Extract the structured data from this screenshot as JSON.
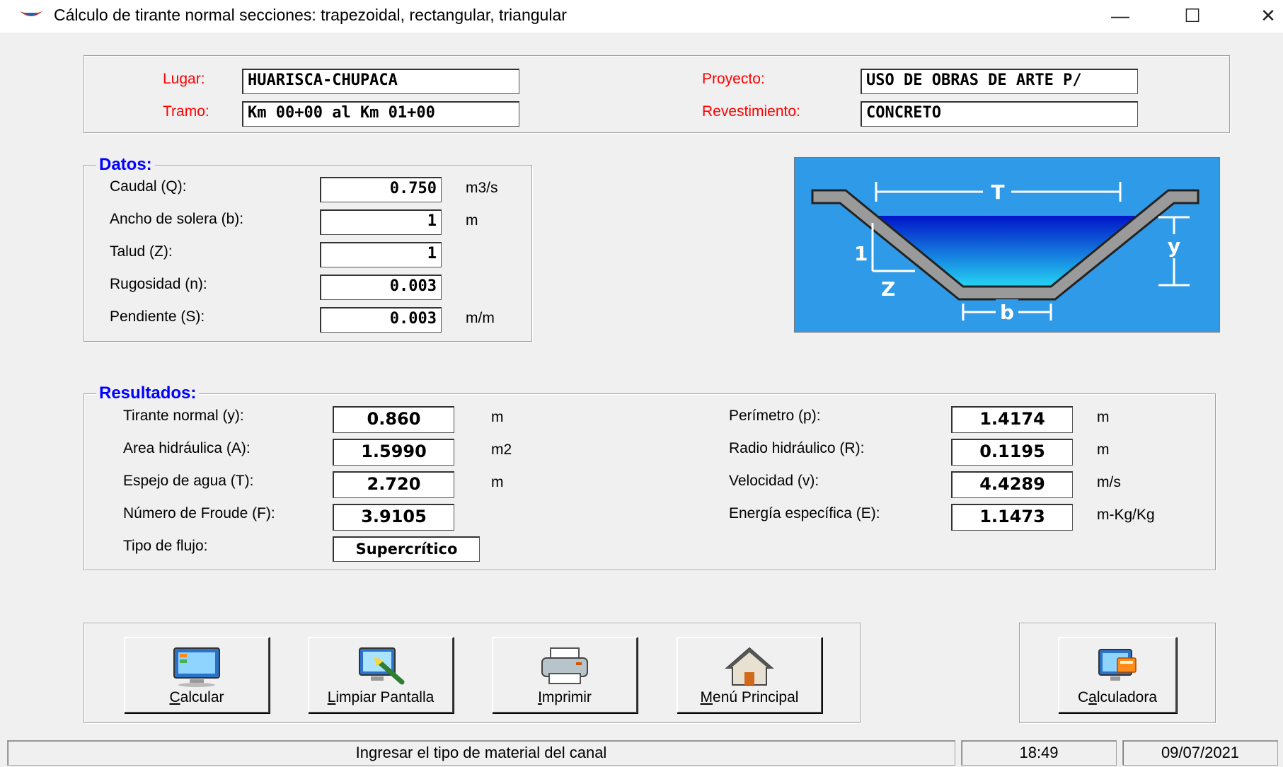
{
  "window": {
    "title": "Cálculo de tirante normal secciones: trapezoidal, rectangular, triangular",
    "minimize_glyph": "—",
    "maximize_glyph": "☐",
    "close_glyph": "✕"
  },
  "header": {
    "lugar_label": "Lugar:",
    "lugar_value": "HUARISCA-CHUPACA",
    "tramo_label": "Tramo:",
    "tramo_value": "Km 00+00 al Km 01+00",
    "proyecto_label": "Proyecto:",
    "proyecto_value": "USO DE OBRAS DE ARTE P/",
    "revestimiento_label": "Revestimiento:",
    "revestimiento_value": "CONCRETO"
  },
  "datos": {
    "legend": "Datos:",
    "caudal_label": "Caudal (Q):",
    "caudal_value": "0.750",
    "caudal_unit": "m3/s",
    "ancho_label": "Ancho de solera (b):",
    "ancho_value": "1",
    "ancho_unit": "m",
    "talud_label": "Talud (Z):",
    "talud_value": "1",
    "rugosidad_label": "Rugosidad (n):",
    "rugosidad_value": "0.003",
    "pendiente_label": "Pendiente (S):",
    "pendiente_value": "0.003",
    "pendiente_unit": "m/m"
  },
  "diagram": {
    "label_T": "T",
    "label_y": "y",
    "label_1": "1",
    "label_Z": "Z",
    "label_b": "b",
    "background_color": "#2f9ae8"
  },
  "resultados": {
    "legend": "Resultados:",
    "tirante_label": "Tirante normal (y):",
    "tirante_value": "0.860",
    "tirante_unit": "m",
    "area_label": "Area hidráulica (A):",
    "area_value": "1.5990",
    "area_unit": "m2",
    "espejo_label": "Espejo de agua (T):",
    "espejo_value": "2.720",
    "espejo_unit": "m",
    "froude_label": "Número de Froude (F):",
    "froude_value": "3.9105",
    "tipo_label": "Tipo de flujo:",
    "tipo_value": "Supercrítico",
    "perimetro_label": "Perímetro (p):",
    "perimetro_value": "1.4174",
    "perimetro_unit": "m",
    "radio_label": "Radio hidráulico (R):",
    "radio_value": "0.1195",
    "radio_unit": "m",
    "velocidad_label": "Velocidad (v):",
    "velocidad_value": "4.4289",
    "velocidad_unit": "m/s",
    "energia_label": "Energía específica (E):",
    "energia_value": "1.1473",
    "energia_unit": "m-Kg/Kg"
  },
  "buttons": {
    "calcular_first": "C",
    "calcular_rest": "alcular",
    "limpiar_first": "L",
    "limpiar_rest": "impiar Pantalla",
    "imprimir_first": "I",
    "imprimir_rest": "mprimir",
    "menu_first": "M",
    "menu_rest": "enú Principal",
    "calculadora_a": "C",
    "calculadora_b": "a",
    "calculadora_c": "lculadora"
  },
  "status": {
    "message": "Ingresar el tipo de material del canal",
    "time": "18:49",
    "date": "09/07/2021"
  }
}
